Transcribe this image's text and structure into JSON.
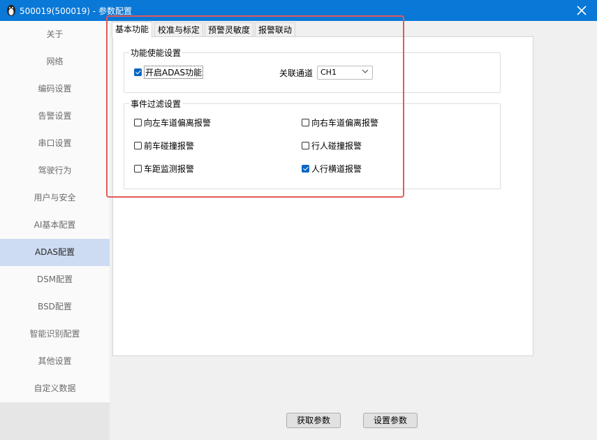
{
  "window": {
    "title": "500019(500019) - 参数配置"
  },
  "sidebar": {
    "items": [
      {
        "label": "关于"
      },
      {
        "label": "网络"
      },
      {
        "label": "编码设置"
      },
      {
        "label": "告警设置"
      },
      {
        "label": "串口设置"
      },
      {
        "label": "驾驶行为"
      },
      {
        "label": "用户与安全"
      },
      {
        "label": "AI基本配置"
      },
      {
        "label": "ADAS配置",
        "selected": true
      },
      {
        "label": "DSM配置"
      },
      {
        "label": "BSD配置"
      },
      {
        "label": "智能识别配置"
      },
      {
        "label": "其他设置"
      },
      {
        "label": "自定义数据"
      }
    ]
  },
  "tabs": [
    {
      "label": "基本功能",
      "active": true
    },
    {
      "label": "校准与标定"
    },
    {
      "label": "预警灵敏度"
    },
    {
      "label": "报警联动"
    }
  ],
  "function_group": {
    "title": "功能使能设置",
    "enable_adas": {
      "label": "开启ADAS功能",
      "checked": true
    },
    "channel_label": "关联通道",
    "channel_value": "CH1"
  },
  "filter_group": {
    "title": "事件过滤设置",
    "items": [
      {
        "label": "向左车道偏离报警",
        "checked": false
      },
      {
        "label": "向右车道偏离报警",
        "checked": false
      },
      {
        "label": "前车碰撞报警",
        "checked": false
      },
      {
        "label": "行人碰撞报警",
        "checked": false
      },
      {
        "label": "车距监测报警",
        "checked": false
      },
      {
        "label": "人行横道报警",
        "checked": true
      }
    ]
  },
  "buttons": {
    "get_params": "获取参数",
    "set_params": "设置参数"
  },
  "colors": {
    "titlebar": "#0a78d7",
    "selected_nav": "#cddcf2",
    "checkbox_checked": "#0a66c2",
    "highlight": "#e05a5a"
  }
}
